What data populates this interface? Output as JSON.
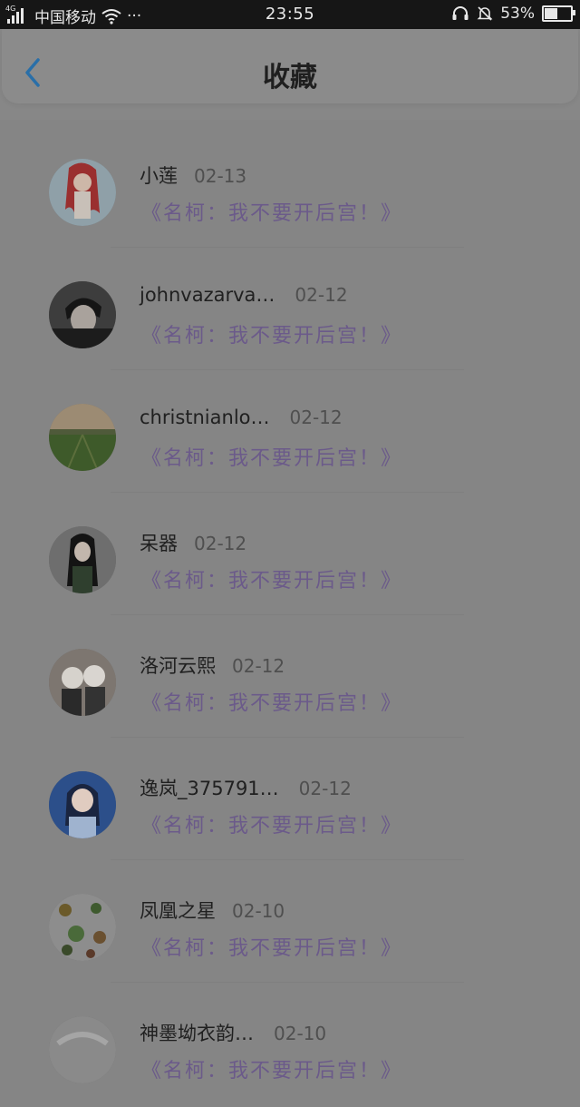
{
  "status_bar": {
    "network_type": "4G",
    "carrier": "中国移动",
    "more": "···",
    "time": "23:55",
    "battery_percent": "53%",
    "battery_level": 0.53
  },
  "header": {
    "title": "收藏",
    "back_icon": "chevron-left-icon"
  },
  "items": [
    {
      "name": "小莲",
      "date": "02-13",
      "title": "《名柯：我不要开后宫！》"
    },
    {
      "name": "johnvazarva…",
      "date": "02-12",
      "title": "《名柯：我不要开后宫！》"
    },
    {
      "name": "christnianlo…",
      "date": "02-12",
      "title": "《名柯：我不要开后宫！》"
    },
    {
      "name": "呆器",
      "date": "02-12",
      "title": "《名柯：我不要开后宫！》"
    },
    {
      "name": "洛河云熙",
      "date": "02-12",
      "title": "《名柯：我不要开后宫！》"
    },
    {
      "name": "逸岚_375791…",
      "date": "02-12",
      "title": "《名柯：我不要开后宫！》"
    },
    {
      "name": "凤凰之星",
      "date": "02-10",
      "title": "《名柯：我不要开后宫！》"
    },
    {
      "name": "神墨坳衣韵…",
      "date": "02-10",
      "title": "《名柯：我不要开后宫！》"
    }
  ],
  "colors": {
    "title_purple": "#6b5a8a",
    "back_blue": "#2a6fa8"
  }
}
